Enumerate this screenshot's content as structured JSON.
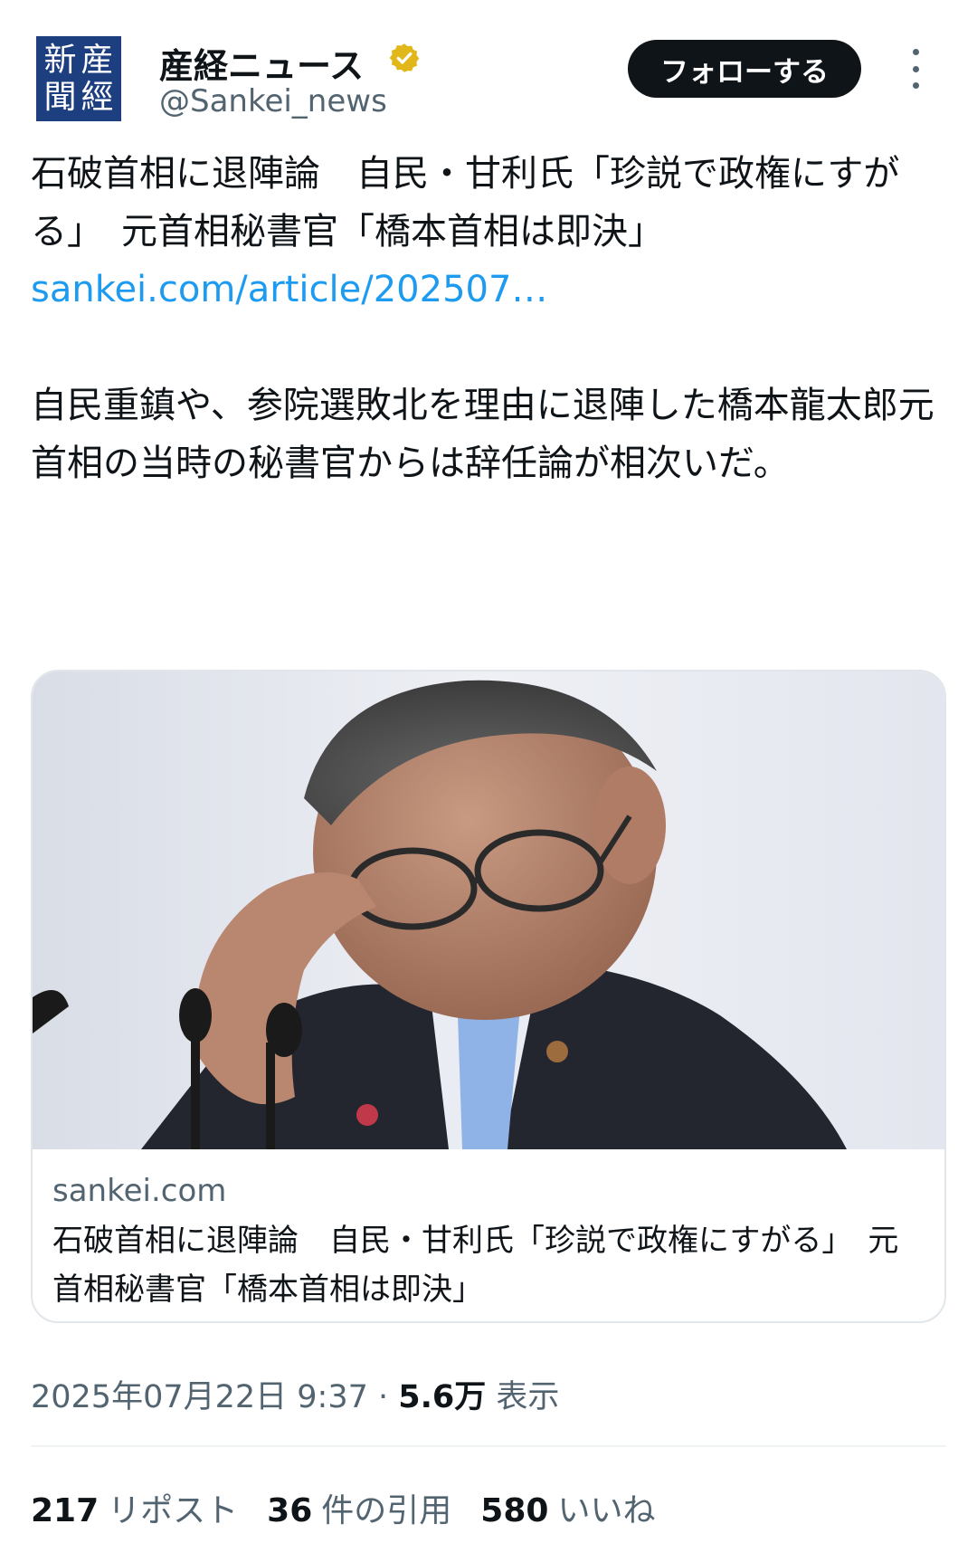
{
  "account": {
    "logo_chars": [
      "新",
      "産",
      "聞",
      "經"
    ],
    "name": "産経ニュース",
    "handle": "@Sankei_news",
    "verified_icon": "verified-badge-icon",
    "verified_color": "#e2b719"
  },
  "actions": {
    "follow_label": "フォローする",
    "more_icon": "more-options-icon"
  },
  "tweet": {
    "headline": "石破首相に退陣論　自民・甘利氏「珍説で政権にすがる」　元首相秘書官「橋本首相は即決」",
    "link": "sankei.com/article/202507…",
    "body": "自民重鎮や、参院選敗北を理由に退陣した橋本龍太郎元首相の当時の秘書官からは辞任論が相次いだ。"
  },
  "card": {
    "domain": "sankei.com",
    "title": "石破首相に退陣論　自民・甘利氏「珍説で政権にすがる」　元首相秘書官「橋本首相は即決」"
  },
  "meta": {
    "timestamp": "2025年07月22日 9:37",
    "separator": " · ",
    "views_count": "5.6万",
    "views_label": " 表示"
  },
  "stats": {
    "reposts_count": "217",
    "reposts_label": "リポスト",
    "quotes_count": "36",
    "quotes_label": "件の引用",
    "likes_count": "580",
    "likes_label": "いいね"
  },
  "colors": {
    "link": "#1d9bf0",
    "secondary_text": "#536471",
    "logo_bg": "#1e3f7f"
  }
}
